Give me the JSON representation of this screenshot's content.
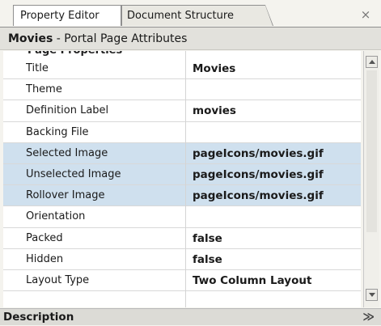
{
  "tabs": [
    {
      "label": "Property Editor",
      "active": true
    },
    {
      "label": "Document Structure",
      "active": false
    }
  ],
  "close_glyph": "×",
  "header": {
    "name": "Movies",
    "suffix": " - Portal Page Attributes"
  },
  "section_label": "Page Properties",
  "properties": [
    {
      "key": "Title",
      "value": "Movies",
      "selected": false
    },
    {
      "key": "Theme",
      "value": "",
      "selected": false
    },
    {
      "key": "Definition Label",
      "value": "movies",
      "selected": false
    },
    {
      "key": "Backing File",
      "value": "",
      "selected": false
    },
    {
      "key": "Selected Image",
      "value": "pageIcons/movies.gif",
      "selected": true
    },
    {
      "key": "Unselected Image",
      "value": "pageIcons/movies.gif",
      "selected": true
    },
    {
      "key": "Rollover Image",
      "value": "pageIcons/movies.gif",
      "selected": true
    },
    {
      "key": "Orientation",
      "value": "",
      "selected": false
    },
    {
      "key": "Packed",
      "value": "false",
      "selected": false
    },
    {
      "key": "Hidden",
      "value": "false",
      "selected": false
    },
    {
      "key": "Layout Type",
      "value": "Two Column Layout",
      "selected": false
    }
  ],
  "description": {
    "label": "Description",
    "collapse_glyph": "≫"
  },
  "colors": {
    "selection": "#cfe0ee"
  }
}
